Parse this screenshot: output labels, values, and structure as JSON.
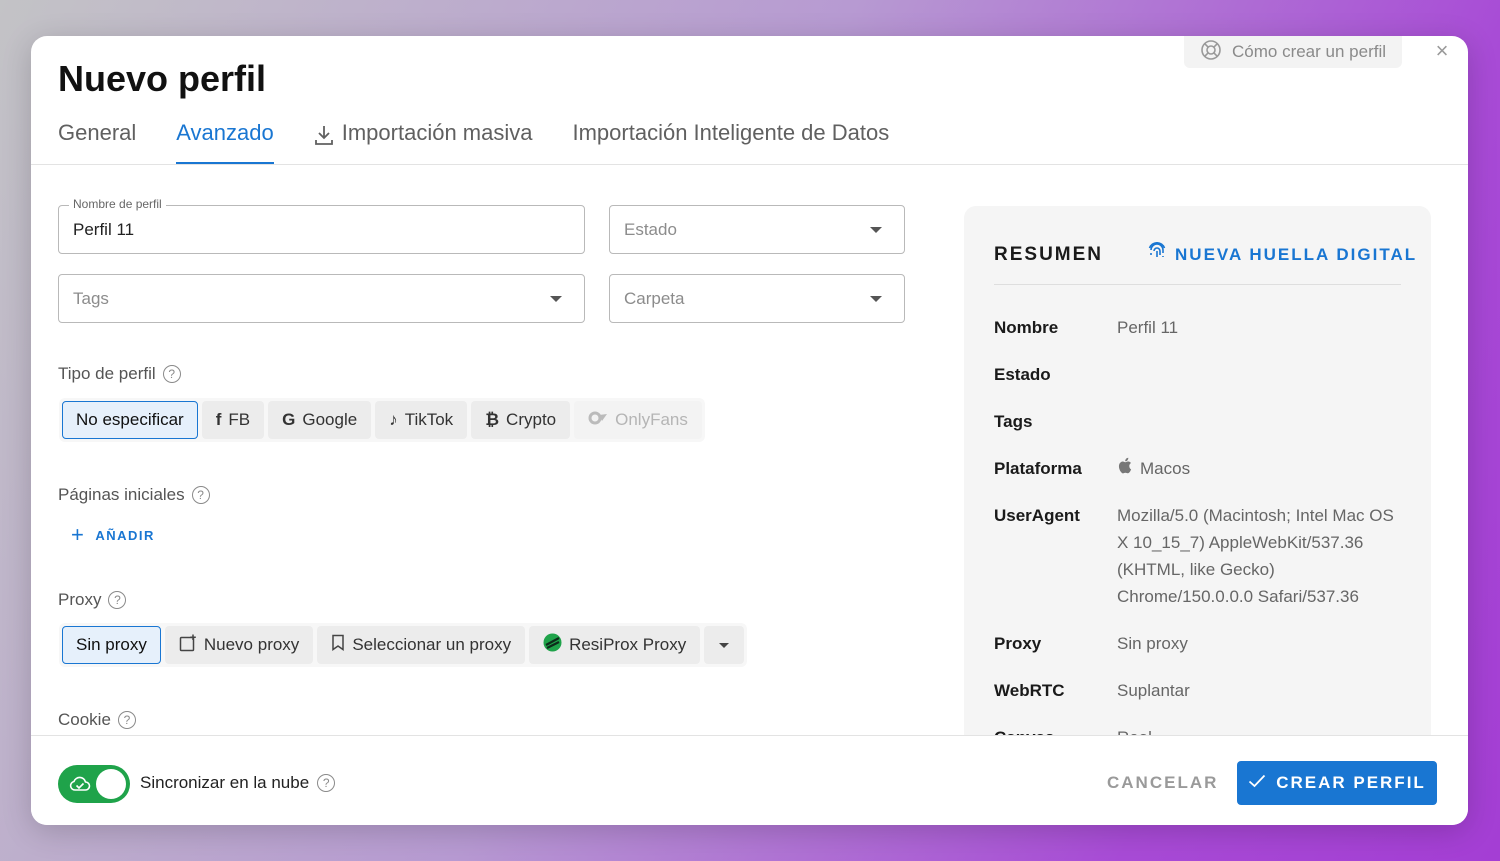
{
  "dialog": {
    "title": "Nuevo perfil",
    "help_link": "Cómo crear un perfil",
    "close_glyph": "×"
  },
  "tabs": [
    {
      "label": "General",
      "active": false
    },
    {
      "label": "Avanzado",
      "active": true
    },
    {
      "label": "Importación masiva",
      "active": false,
      "icon": "download-icon"
    },
    {
      "label": "Importación Inteligente de Datos",
      "active": false
    }
  ],
  "form": {
    "profile_name": {
      "legend": "Nombre de perfil",
      "value": "Perfil 11"
    },
    "estado": {
      "placeholder": "Estado"
    },
    "tags": {
      "placeholder": "Tags"
    },
    "carpeta": {
      "placeholder": "Carpeta"
    },
    "tipo_perfil": {
      "label": "Tipo de perfil",
      "options": [
        {
          "label": "No especificar",
          "selected": true,
          "icon": ""
        },
        {
          "label": "FB",
          "icon": "f"
        },
        {
          "label": "Google",
          "icon": "G"
        },
        {
          "label": "TikTok",
          "icon": "♪"
        },
        {
          "label": "Crypto",
          "icon": "₿"
        },
        {
          "label": "OnlyFans",
          "icon": "⬮",
          "disabled": true
        }
      ]
    },
    "paginas": {
      "label": "Páginas iniciales",
      "add_label": "AÑADIR"
    },
    "proxy": {
      "label": "Proxy",
      "options": [
        {
          "label": "Sin proxy",
          "selected": true
        },
        {
          "label": "Nuevo proxy",
          "icon": "new-proxy-icon"
        },
        {
          "label": "Seleccionar un proxy",
          "icon": "bookmark-icon"
        },
        {
          "label": "ResiProx Proxy",
          "icon": "resiprox-logo-icon"
        }
      ]
    },
    "cookie": {
      "label": "Cookie"
    }
  },
  "summary": {
    "title": "RESUMEN",
    "fingerprint_label": "NUEVA HUELLA DIGITAL",
    "rows": [
      {
        "key": "Nombre",
        "value": "Perfil 11"
      },
      {
        "key": "Estado",
        "value": ""
      },
      {
        "key": "Tags",
        "value": ""
      },
      {
        "key": "Plataforma",
        "value": "Macos"
      },
      {
        "key": "UserAgent",
        "value": "Mozilla/5.0 (Macintosh; Intel Mac OS X 10_15_7) AppleWebKit/537.36 (KHTML, like Gecko) Chrome/150.0.0.0 Safari/537.36"
      },
      {
        "key": "Proxy",
        "value": "Sin proxy"
      },
      {
        "key": "WebRTC",
        "value": "Suplantar"
      },
      {
        "key": "Canvas",
        "value": "Real"
      }
    ]
  },
  "footer": {
    "sync_label": "Sincronizar en la nube",
    "sync_enabled": true,
    "cancel_label": "CANCELAR",
    "create_label": "CREAR PERFIL"
  },
  "colors": {
    "accent": "#1976d2",
    "toggle_on": "#1fa34a"
  }
}
